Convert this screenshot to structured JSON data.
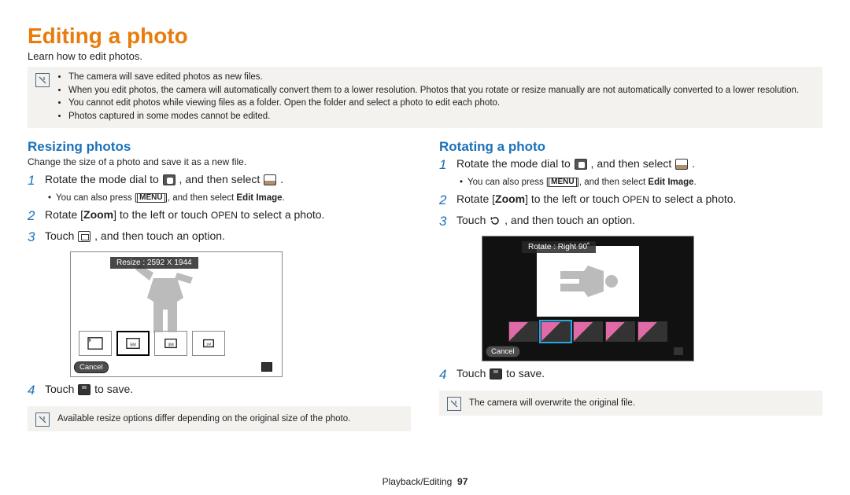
{
  "page": {
    "title": "Editing a photo",
    "subtitle": "Learn how to edit photos."
  },
  "top_notes": [
    "The camera will save edited photos as new files.",
    "When you edit photos, the camera will automatically convert them to a lower resolution. Photos that you rotate or resize manually are not automatically converted to a lower resolution.",
    "You cannot edit photos while viewing files as a folder. Open the folder and select a photo to edit each photo.",
    "Photos captured in some modes cannot be edited."
  ],
  "left": {
    "heading": "Resizing photos",
    "intro": "Change the size of a photo and save it as a new file.",
    "step1_a": "Rotate the mode dial to ",
    "step1_b": ", and then select ",
    "step1_c": ".",
    "menu_a": "You can also press [",
    "menu_label": "MENU",
    "menu_b": "], and then select ",
    "menu_bold": "Edit Image",
    "menu_c": ".",
    "step2_a": "Rotate [",
    "step2_zoom": "Zoom",
    "step2_b": "] to the left or touch ",
    "step2_open": "OPEN",
    "step2_c": " to select a photo.",
    "step3_a": "Touch ",
    "step3_b": ", and then touch an option.",
    "caption": "Resize : 2592 X 1944",
    "cancel": "Cancel",
    "step4_a": "Touch ",
    "step4_b": " to save.",
    "note": "Available resize options differ depending on the original size of the photo."
  },
  "right": {
    "heading": "Rotating a photo",
    "step1_a": "Rotate the mode dial to ",
    "step1_b": ", and then select ",
    "step1_c": ".",
    "menu_a": "You can also press [",
    "menu_label": "MENU",
    "menu_b": "], and then select ",
    "menu_bold": "Edit Image",
    "menu_c": ".",
    "step2_a": "Rotate [",
    "step2_zoom": "Zoom",
    "step2_b": "] to the left or touch ",
    "step2_open": "OPEN",
    "step2_c": " to select a photo.",
    "step3_a": "Touch ",
    "step3_b": ", and then touch an option.",
    "caption": "Rotate : Right 90˚",
    "cancel": "Cancel",
    "step4_a": "Touch ",
    "step4_b": " to save.",
    "note": "The camera will overwrite the original file."
  },
  "footer": {
    "section": "Playback/Editing",
    "page_number": "97"
  }
}
